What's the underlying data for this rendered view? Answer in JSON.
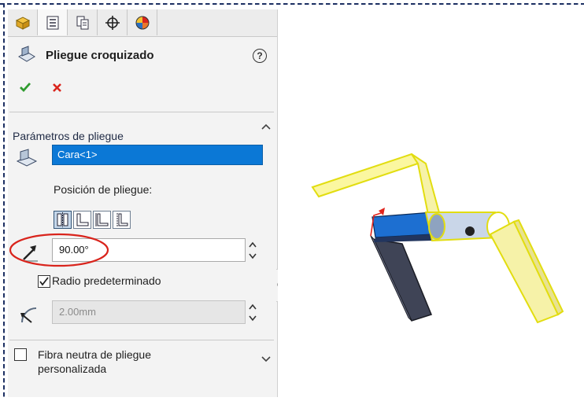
{
  "panel": {
    "tabs": [
      "featuremanager-tab",
      "propertymanager-tab",
      "configurationmanager-tab",
      "dimxpert-tab",
      "displaymanager-tab"
    ],
    "title": "Pliegue croquizado",
    "help_icon": "question-icon",
    "ok_icon": "check-icon",
    "cancel_icon": "close-icon"
  },
  "bend_parameters": {
    "section_title": "Parámetros de pliegue",
    "face_value": "Cara<1>",
    "bend_position_label": "Posición de pliegue:",
    "bend_positions": [
      "bend-centerline",
      "material-inside",
      "material-outside",
      "bend-outside"
    ],
    "selected_position_index": 0,
    "angle_value": "90.00°",
    "default_radius_label": "Radio predeterminado",
    "default_radius_checked": true,
    "radius_value": "2.00mm"
  },
  "custom_fiber": {
    "label_line1": "Fibra neutra de pliegue",
    "label_line2": "personalizada",
    "checked": false
  },
  "colors": {
    "accent_blue": "#0b78d6",
    "highlight_red": "#d9241c",
    "selection_yellow": "#f0ec14",
    "panel_bg": "#f3f3f3"
  }
}
